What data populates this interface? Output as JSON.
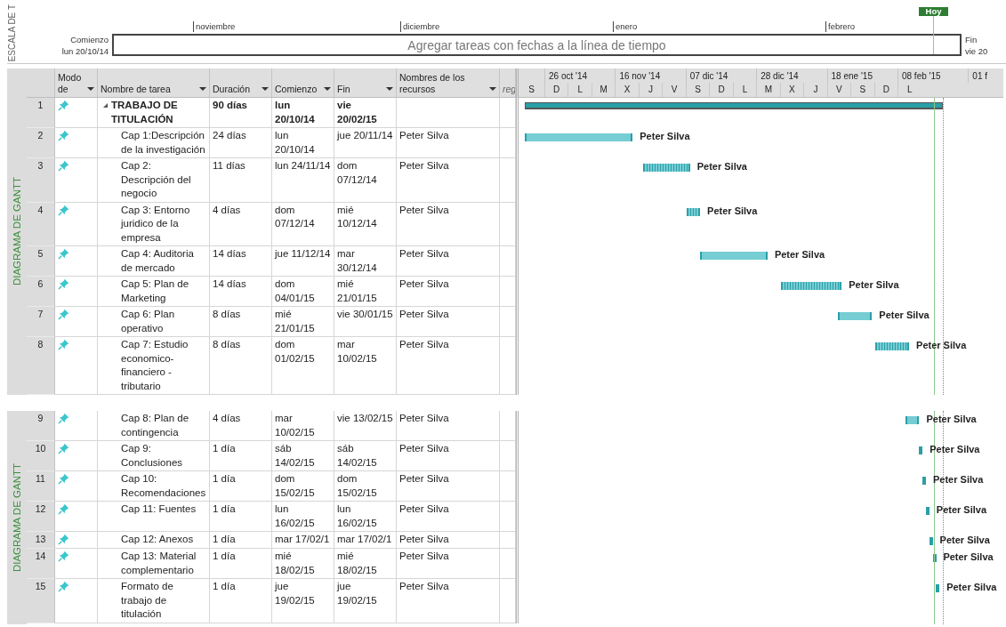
{
  "timeline": {
    "side_label": "ESCALA DE T",
    "start_label": "Comienzo",
    "start_date": "lun 20/10/14",
    "end_label": "Fin",
    "end_date": "vie 20",
    "months": [
      "noviembre",
      "diciembre",
      "enero",
      "febrero"
    ],
    "prompt": "Agregar tareas con fechas a la línea de tiempo",
    "today": "Hoy"
  },
  "panels": [
    {
      "side_label": "DIAGRAMA DE GANTT",
      "columns": [
        {
          "label": "Modo de",
          "kind": "mode"
        },
        {
          "label": "Nombre de tarea",
          "kind": "name"
        },
        {
          "label": "Duración",
          "kind": "duration"
        },
        {
          "label": "Comienzo",
          "kind": "start"
        },
        {
          "label": "Fin",
          "kind": "finish"
        },
        {
          "label": "Nombres de los recursos",
          "kind": "resources"
        },
        {
          "label": "reg",
          "kind": "extra"
        }
      ],
      "timescale": {
        "major": [
          "26 oct '14",
          "16 nov '14",
          "07 dic '14",
          "28 dic '14",
          "18 ene '15",
          "08 feb '15",
          "01 f"
        ],
        "minor": [
          "S",
          "D",
          "L",
          "M",
          "X",
          "J",
          "V",
          "S",
          "D",
          "L",
          "M",
          "X",
          "J",
          "V",
          "S",
          "D",
          "L"
        ]
      },
      "tasks": [
        {
          "id": "1",
          "kind": "summary",
          "expanded": true,
          "name": "TRABAJO DE TITULACIÓN",
          "duration": "90 días",
          "start": "lun 20/10/14",
          "finish": "vie 20/02/15"
        },
        {
          "id": "2",
          "kind": "solid",
          "name": "Cap 1:Descripción de la investigación",
          "duration": "24 días",
          "start": "lun 20/10/14",
          "finish": "jue 20/11/14",
          "resources": "Peter Silva",
          "bar_label": "Peter Silva"
        },
        {
          "id": "3",
          "kind": "hatched",
          "name": "Cap 2: Descripción del negocio",
          "duration": "11 días",
          "start": "lun 24/11/14",
          "finish": "dom 07/12/14",
          "resources": "Peter Silva",
          "bar_label": "Peter Silva"
        },
        {
          "id": "4",
          "kind": "hatched",
          "name": "Cap 3: Entorno juridico de la empresa",
          "duration": "4 días",
          "start": "dom 07/12/14",
          "finish": "mié 10/12/14",
          "resources": "Peter Silva",
          "bar_label": "Peter Silva"
        },
        {
          "id": "5",
          "kind": "solid",
          "name": "Cap 4: Auditoria de mercado",
          "duration": "14 días",
          "start": "jue 11/12/14",
          "finish": "mar 30/12/14",
          "resources": "Peter Silva",
          "bar_label": "Peter Silva"
        },
        {
          "id": "6",
          "kind": "hatched",
          "name": "Cap 5: Plan de Marketing",
          "duration": "14 días",
          "start": "dom 04/01/15",
          "finish": "mié 21/01/15",
          "resources": "Peter Silva",
          "bar_label": "Peter Silva"
        },
        {
          "id": "7",
          "kind": "solid",
          "name": "Cap 6: Plan operativo",
          "duration": "8 días",
          "start": "mié 21/01/15",
          "finish": "vie 30/01/15",
          "resources": "Peter Silva",
          "bar_label": "Peter Silva"
        },
        {
          "id": "8",
          "kind": "hatched",
          "name": "Cap 7: Estudio economico-financiero - tributario",
          "duration": "8 días",
          "start": "dom 01/02/15",
          "finish": "mar 10/02/15",
          "resources": "Peter Silva",
          "bar_label": "Peter Silva"
        }
      ]
    },
    {
      "side_label": "DIAGRAMA DE GANTT",
      "tasks": [
        {
          "id": "9",
          "kind": "solid",
          "name": "Cap 8: Plan de contingencia",
          "duration": "4 días",
          "start": "mar 10/02/15",
          "finish": "vie 13/02/15",
          "resources": "Peter Silva",
          "bar_label": "Peter Silva"
        },
        {
          "id": "10",
          "kind": "solid",
          "name": "Cap 9: Conclusiones",
          "duration": "1 día",
          "start": "sáb 14/02/15",
          "finish": "sáb 14/02/15",
          "resources": "Peter Silva",
          "bar_label": "Peter Silva"
        },
        {
          "id": "11",
          "kind": "solid",
          "name": "Cap 10: Recomendaciones",
          "duration": "1 día",
          "start": "dom 15/02/15",
          "finish": "dom 15/02/15",
          "resources": "Peter Silva",
          "bar_label": "Peter Silva"
        },
        {
          "id": "12",
          "kind": "solid",
          "name": "Cap 11: Fuentes",
          "duration": "1 día",
          "start": "lun 16/02/15",
          "finish": "lun 16/02/15",
          "resources": "Peter Silva",
          "bar_label": "Peter Silva"
        },
        {
          "id": "13",
          "kind": "solid",
          "name": "Cap 12: Anexos",
          "duration": "1 día",
          "start": "mar 17/02/1",
          "finish": "mar 17/02/1",
          "resources": "Peter Silva",
          "bar_label": "Peter Silva"
        },
        {
          "id": "14",
          "kind": "solid",
          "name": "Cap 13: Material complementario",
          "duration": "1 día",
          "start": "mié 18/02/15",
          "finish": "mié 18/02/15",
          "resources": "Peter Silva",
          "bar_label": "Peter Silva"
        },
        {
          "id": "15",
          "kind": "solid",
          "name": "Formato de trabajo de titulación",
          "duration": "1 día",
          "start": "jue 19/02/15",
          "finish": "jue 19/02/15",
          "resources": "Peter Silva",
          "bar_label": "Peter Silva"
        }
      ]
    }
  ]
}
